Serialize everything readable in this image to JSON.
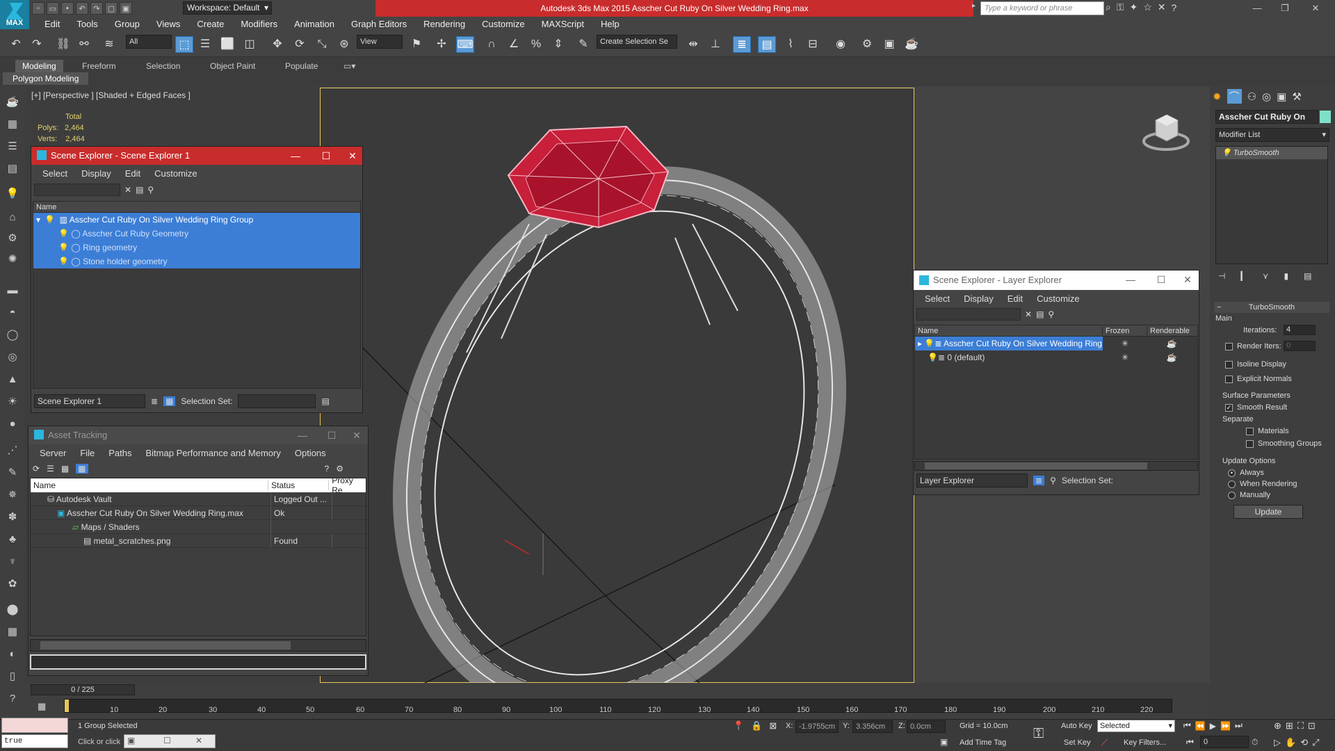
{
  "app": {
    "logo_text": "MAX",
    "title": "Autodesk 3ds Max  2015     Asscher Cut Ruby On Silver Wedding Ring.max",
    "workspace": "Workspace: Default",
    "search_placeholder": "Type a keyword or phrase",
    "accent_color": "#c92c2c"
  },
  "menus": [
    "Edit",
    "Tools",
    "Group",
    "Views",
    "Create",
    "Modifiers",
    "Animation",
    "Graph Editors",
    "Rendering",
    "Customize",
    "MAXScript",
    "Help"
  ],
  "toolbar": {
    "selection_filter": "All",
    "coord_system": "View",
    "create_selection_set": "Create Selection Se",
    "icons": [
      "undo-icon",
      "redo-icon",
      "link-icon",
      "unlink-icon",
      "bind-spacewarp-icon",
      "select-object-icon",
      "select-by-name-icon",
      "rect-region-icon",
      "window-crossing-icon",
      "move-icon",
      "rotate-icon",
      "scale-icon",
      "placement-icon",
      "pivot-icon",
      "snap-icon",
      "angle-snap-icon",
      "percent-snap-icon",
      "spinner-snap-icon",
      "edit-named-sets-icon",
      "mirror-icon",
      "align-icon",
      "layer-explorer-icon",
      "toggle-ribbon-icon",
      "curve-editor-icon",
      "schematic-icon",
      "material-editor-icon",
      "render-setup-icon",
      "rendered-frame-icon",
      "render-icon"
    ]
  },
  "ribbon": {
    "tabs": [
      "Modeling",
      "Freeform",
      "Selection",
      "Object Paint",
      "Populate"
    ],
    "active": "Modeling",
    "sub_label": "Polygon Modeling"
  },
  "viewport": {
    "label": "[+] [Perspective ] [Shaded + Edged Faces ]",
    "stats_header": "Total",
    "polys_label": "Polys:",
    "polys_value": "2,464",
    "verts_label": "Verts:",
    "verts_value": "2,464"
  },
  "scene_explorer": {
    "title": "Scene Explorer - Scene Explorer 1",
    "menu": [
      "Select",
      "Display",
      "Edit",
      "Customize"
    ],
    "col_name": "Name",
    "rows": [
      "Asscher Cut Ruby On Silver Wedding Ring Group",
      "Asscher Cut Ruby Geometry",
      "Ring geometry",
      "Stone holder geometry"
    ],
    "footer_name": "Scene Explorer 1",
    "selection_set_label": "Selection Set:"
  },
  "asset_tracking": {
    "title": "Asset Tracking",
    "menu": [
      "Server",
      "File",
      "Paths",
      "Bitmap Performance and Memory",
      "Options"
    ],
    "columns": [
      "Name",
      "Status",
      "Proxy Re"
    ],
    "rows": [
      {
        "name": "Autodesk Vault",
        "status": "Logged Out ..."
      },
      {
        "name": "Asscher Cut Ruby On Silver Wedding Ring.max",
        "status": "Ok"
      },
      {
        "name": "Maps / Shaders",
        "status": ""
      },
      {
        "name": "metal_scratches.png",
        "status": "Found"
      }
    ]
  },
  "layer_explorer": {
    "title": "Scene Explorer - Layer Explorer",
    "menu": [
      "Select",
      "Display",
      "Edit",
      "Customize"
    ],
    "columns": [
      "Name",
      "Frozen",
      "Renderable"
    ],
    "rows": [
      "Asscher Cut Ruby On Silver Wedding Ring",
      "0 (default)"
    ],
    "footer_name": "Layer Explorer",
    "selection_set_label": "Selection Set:"
  },
  "command_panel": {
    "object_name": "Asscher Cut Ruby On Silv",
    "object_color": "#7fe0c8",
    "modifier_list": "Modifier List",
    "stack_item": "TurboSmooth",
    "rollout_title": "TurboSmooth",
    "main_label": "Main",
    "iterations_label": "Iterations:",
    "iterations_value": "4",
    "render_iters_label": "Render Iters:",
    "render_iters_value": "0",
    "isoline": "Isoline Display",
    "explicit_normals": "Explicit Normals",
    "surface_params": "Surface Parameters",
    "smooth_result": "Smooth Result",
    "separate": "Separate",
    "materials": "Materials",
    "smoothing_groups": "Smoothing Groups",
    "update_options": "Update Options",
    "always": "Always",
    "when_rendering": "When Rendering",
    "manually": "Manually",
    "update_button": "Update"
  },
  "timeline": {
    "frame_display": "0 / 225",
    "ticks": [
      "10",
      "20",
      "30",
      "40",
      "50",
      "60",
      "70",
      "80",
      "90",
      "100",
      "110",
      "120",
      "130",
      "140",
      "150",
      "160",
      "170",
      "180",
      "190",
      "200",
      "210",
      "220"
    ]
  },
  "status": {
    "script_value": "true",
    "selection_text": "1 Group Selected",
    "prompt_text": "Click or click",
    "x_label": "X:",
    "x_value": "-1.9755cm",
    "y_label": "Y:",
    "y_value": "3.356cm",
    "z_label": "Z:",
    "z_value": "0.0cm",
    "grid": "Grid = 10.0cm",
    "auto_key": "Auto Key",
    "selected": "Selected",
    "set_key": "Set Key",
    "key_filters": "Key Filters...",
    "add_time_tag": "Add Time Tag",
    "frame": "0"
  }
}
